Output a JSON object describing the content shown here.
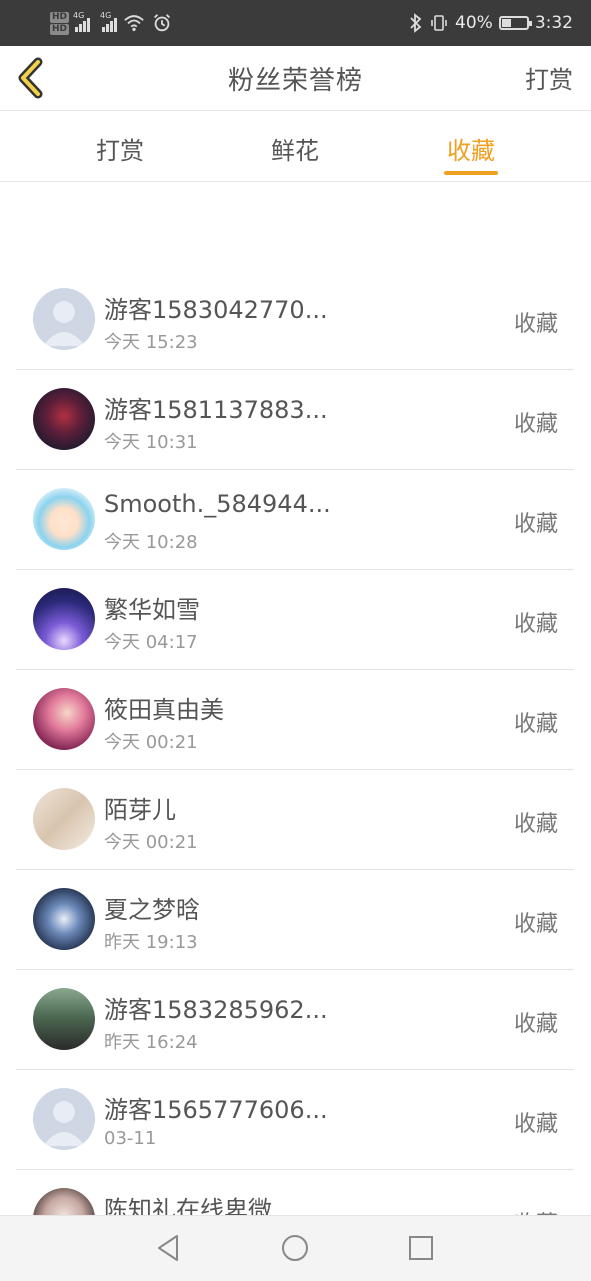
{
  "status_bar": {
    "hd1": "HD",
    "hd2": "HD",
    "net1": "4G",
    "net2": "4G",
    "battery": "40%",
    "battery_level": 0.4,
    "time": "3:32"
  },
  "header": {
    "title": "粉丝荣誉榜",
    "right_action": "打赏"
  },
  "tabs": [
    {
      "label": "打赏",
      "active": false
    },
    {
      "label": "鲜花",
      "active": false
    },
    {
      "label": "收藏",
      "active": true
    }
  ],
  "rows": [
    {
      "name": "游客1583042770...",
      "time": "今天 15:23",
      "action": "收藏",
      "avatar": "default"
    },
    {
      "name": "游客1581137883...",
      "time": "今天 10:31",
      "action": "收藏",
      "avatar": "dark-red"
    },
    {
      "name": "Smooth._584944...",
      "time": "今天 10:28",
      "action": "收藏",
      "avatar": "cartoon-boy"
    },
    {
      "name": "繁华如雪",
      "time": "今天 04:17",
      "action": "收藏",
      "avatar": "purple-sky"
    },
    {
      "name": "筱田真由美",
      "time": "今天 00:21",
      "action": "收藏",
      "avatar": "anime-girl"
    },
    {
      "name": "陌芽儿",
      "time": "今天 00:21",
      "action": "收藏",
      "avatar": "beige"
    },
    {
      "name": "夏之梦晗",
      "time": "昨天 19:13",
      "action": "收藏",
      "avatar": "blue-anime"
    },
    {
      "name": "游客1583285962...",
      "time": "昨天 16:24",
      "action": "收藏",
      "avatar": "photo-green"
    },
    {
      "name": "游客1565777606...",
      "time": "03-11",
      "action": "收藏",
      "avatar": "default"
    },
    {
      "name": "陈知礼在线卑微",
      "time": "",
      "action": "收藏",
      "avatar": "photo-girl"
    }
  ],
  "colors": {
    "accent": "#f0a020",
    "status_bar_bg": "#3b3b3b",
    "text": "#555555",
    "subtext": "#999999"
  }
}
